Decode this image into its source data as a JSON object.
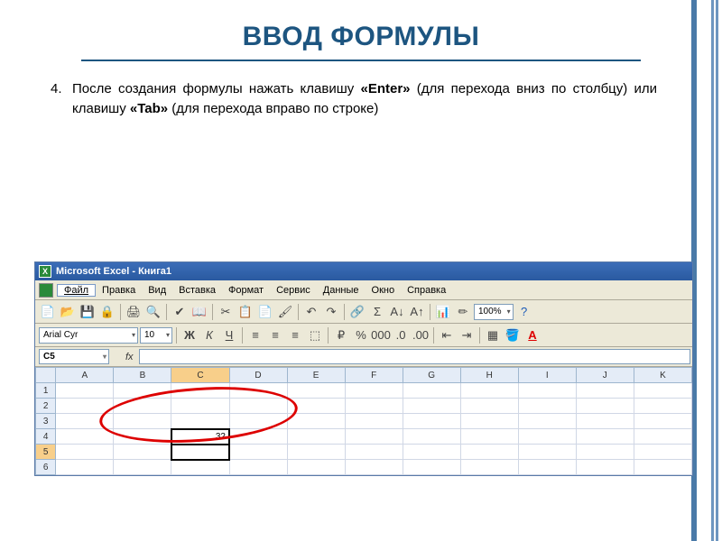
{
  "slide": {
    "title": "ВВОД ФОРМУЛЫ",
    "item_number": "4.",
    "paragraph_parts": {
      "p1": "После создания формулы нажать клавишу ",
      "b1": "«Enter»",
      "p2": " (для перехода вниз по столбцу) или клавишу ",
      "b2": "«Tab»",
      "p3": " (для перехода вправо по строке)"
    }
  },
  "excel": {
    "title": "Microsoft Excel - Книга1",
    "menus": [
      "Файл",
      "Правка",
      "Вид",
      "Вставка",
      "Формат",
      "Сервис",
      "Данные",
      "Окно",
      "Справка"
    ],
    "menu_underline_idx": [
      0,
      0,
      0,
      2,
      2,
      0,
      0,
      0,
      0
    ],
    "font_name": "Arial Cyr",
    "font_size": "10",
    "zoom": "100%",
    "bold": "Ж",
    "italic": "К",
    "underline": "Ч",
    "namebox": "C5",
    "fx_label": "fx",
    "columns": [
      "A",
      "B",
      "C",
      "D",
      "E",
      "F",
      "G",
      "H",
      "I",
      "J",
      "K"
    ],
    "rows": [
      "1",
      "2",
      "3",
      "4",
      "5",
      "6"
    ],
    "result_cell": {
      "row": "4",
      "col": "C",
      "value": "32"
    },
    "active_cell": {
      "row": "5",
      "col": "C"
    }
  }
}
